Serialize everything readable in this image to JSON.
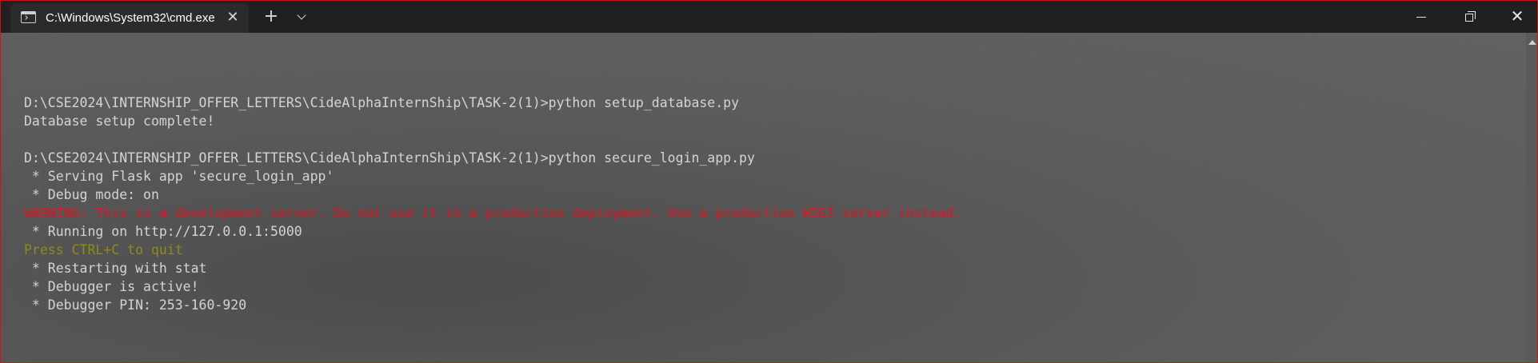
{
  "tab": {
    "title": "C:\\Windows\\System32\\cmd.exe",
    "icon": "terminal-icon"
  },
  "titlebar": {
    "new_tab_symbol": "+",
    "close_tab_symbol": "✕",
    "close_window_symbol": "✕"
  },
  "terminal": {
    "lines": [
      {
        "text": "",
        "kind": "normal"
      },
      {
        "text": "D:\\CSE2024\\INTERNSHIP_OFFER_LETTERS\\CideAlphaInternShip\\TASK-2(1)>python setup_database.py",
        "kind": "normal"
      },
      {
        "text": "Database setup complete!",
        "kind": "normal"
      },
      {
        "text": "",
        "kind": "normal"
      },
      {
        "text": "D:\\CSE2024\\INTERNSHIP_OFFER_LETTERS\\CideAlphaInternShip\\TASK-2(1)>python secure_login_app.py",
        "kind": "normal"
      },
      {
        "text": " * Serving Flask app 'secure_login_app'",
        "kind": "normal"
      },
      {
        "text": " * Debug mode: on",
        "kind": "normal"
      },
      {
        "text": "WARNING: This is a development server. Do not use it in a production deployment. Use a production WSGI server instead.",
        "kind": "warn"
      },
      {
        "text": " * Running on http://127.0.0.1:5000",
        "kind": "normal"
      },
      {
        "text": "Press CTRL+C to quit",
        "kind": "hint"
      },
      {
        "text": " * Restarting with stat",
        "kind": "normal"
      },
      {
        "text": " * Debugger is active!",
        "kind": "normal"
      },
      {
        "text": " * Debugger PIN: 253-160-920",
        "kind": "normal"
      }
    ]
  },
  "colors": {
    "accent_border": "#c8141c",
    "warning_text": "#e8101c",
    "hint_text": "#908a1a",
    "normal_text": "#d4d4d4"
  }
}
